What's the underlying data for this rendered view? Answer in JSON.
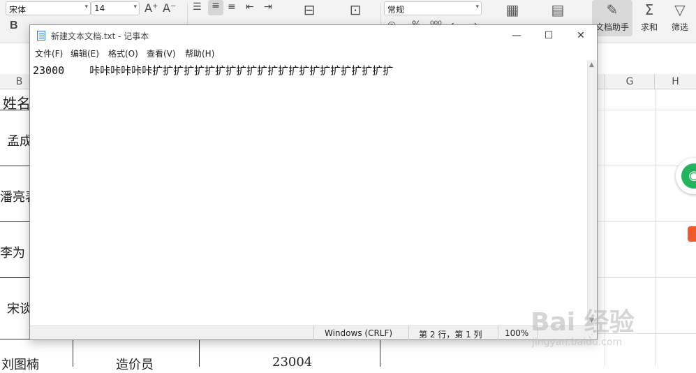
{
  "ribbon": {
    "font_name": "宋体",
    "font_size": "14",
    "grow_font": "A⁺",
    "shrink_font": "A⁻",
    "bold": "B",
    "number_format": "常规",
    "doc_helper_label": "文档助手",
    "sum_label": "求和",
    "filter_label": "筛选"
  },
  "sheet": {
    "columns": [
      "B",
      "G",
      "H"
    ],
    "cells": {
      "header_name": "姓名",
      "row1_name": "孟成",
      "row2_name": "潘亮表",
      "row3_name": "李为",
      "row4_name": "宋谈",
      "row5_name": "刘图楠",
      "row5_title": "造价员",
      "row5_value": "23004"
    }
  },
  "notepad": {
    "title": "新建文本文档.txt - 记事本",
    "menu": [
      "文件(F)",
      "编辑(E)",
      "格式(O)",
      "查看(V)",
      "帮助(H)"
    ],
    "content": "23000    咔咔咔咔咔咔扩扩扩扩扩扩扩扩扩扩扩扩扩扩扩扩扩扩扩扩扩扩扩",
    "status": {
      "line_ending": "Windows (CRLF)",
      "cursor": "第 2 行，第 1 列",
      "zoom": "100%"
    }
  },
  "watermark": {
    "brand": "Bai 经验",
    "url": "jingyan.baidu.com"
  }
}
